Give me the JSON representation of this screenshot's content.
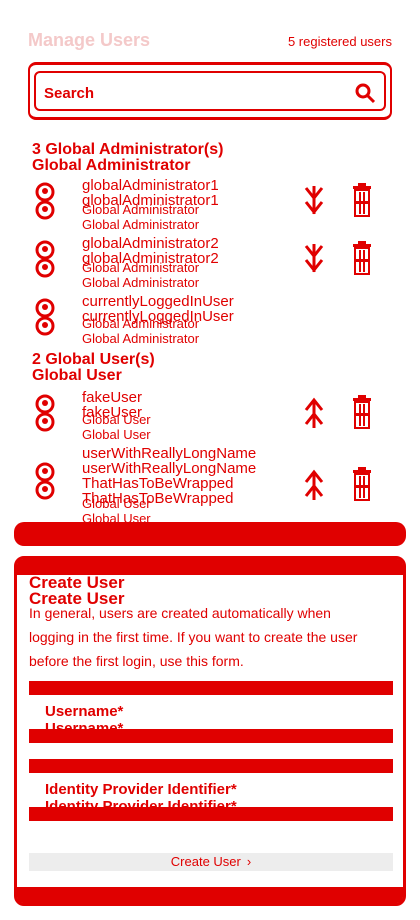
{
  "header": {
    "title": "Manage Users",
    "user_count": "5 registered users"
  },
  "search": {
    "label": "Search"
  },
  "sections": [
    {
      "heading": "3 Global Administrator(s)",
      "subheading": "Global Administrator",
      "users": [
        {
          "name": "globalAdministrator1",
          "role": "Global Administrator",
          "role_action": "demote",
          "can_delete": true
        },
        {
          "name": "globalAdministrator2",
          "role": "Global Administrator",
          "role_action": "demote",
          "can_delete": true
        },
        {
          "name": "currentlyLoggedInUser",
          "role": "Global Administrator",
          "role_action": "none",
          "can_delete": false
        }
      ]
    },
    {
      "heading": "2 Global User(s)",
      "subheading": "Global User",
      "users": [
        {
          "name": "fakeUser",
          "role": "Global User",
          "role_action": "promote",
          "can_delete": true
        },
        {
          "name": "userWithReallyLongNameThatHasToBeWrapped",
          "name_line1": "userWithReallyLongName",
          "name_line2": "ThatHasToBeWrapped",
          "role": "Global User",
          "role_action": "promote",
          "can_delete": true
        }
      ]
    }
  ],
  "create_user": {
    "title": "Create User",
    "description": "In general, users are created automatically when logging in the first time. If you want to create the user before the first login, use this form.",
    "username_label": "Username*",
    "idp_label": "Identity Provider Identifier*",
    "button_label": "Create User"
  },
  "colors": {
    "accent": "#e00000",
    "muted_title": "#f4c9c9",
    "button_bg": "#ededed"
  },
  "icons": {
    "search": "search-icon",
    "avatar": "user-avatar-icon",
    "demote": "arrow-down-icon",
    "promote": "arrow-up-icon",
    "delete": "trash-icon",
    "chevron": "chevron-right-icon"
  }
}
